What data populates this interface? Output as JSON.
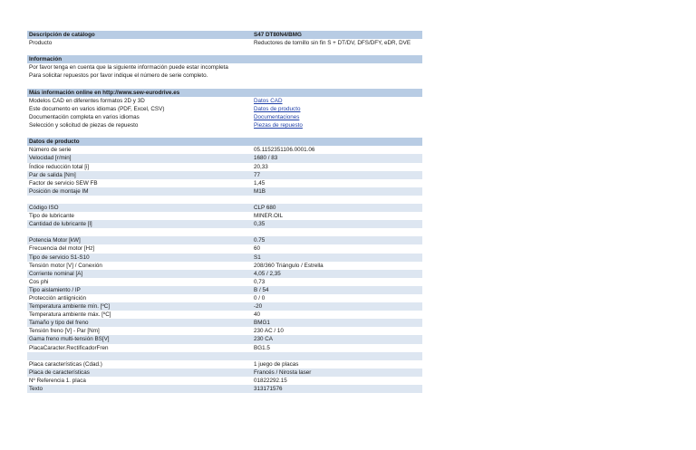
{
  "catalog": {
    "header_label": "Descripción de catálogo",
    "header_value": "S47 DT80N4/BMG",
    "product_label": "Producto",
    "product_value": "Reductores de tornillo sin fin S + DT/DV, DFS/DFY, eDR, DVE"
  },
  "info": {
    "title": "Información",
    "line1": "Por favor tenga en cuenta que la siguiente información puede estar incompleta",
    "line2": "Para solicitar repuestos por favor indique el número de serie completo."
  },
  "online": {
    "title": "Más información online en http://www.sew-eurodrive.es",
    "rows": [
      {
        "label": "Modelos CAD en diferentes formatos 2D y 3D",
        "link": "Datos CAD"
      },
      {
        "label": "Este documento en varios idiomas (PDF, Excel, CSV)",
        "link": "Datos de producto"
      },
      {
        "label": "Documentación completa en varios idiomas",
        "link": "Documentaciones"
      },
      {
        "label": "Selección y solicitud de piezas de repuesto",
        "link": "Piezas de repuesto"
      }
    ]
  },
  "product_data": {
    "title": "Datos de producto",
    "group1": [
      {
        "label": "Número de serie",
        "value": "05.1152351106.0001.06"
      },
      {
        "label": "Velocidad [r/min]",
        "value": "1680 / 83"
      },
      {
        "label": "Índice reducción total [i]",
        "value": "20,33"
      },
      {
        "label": "Par de salida [Nm]",
        "value": "77"
      },
      {
        "label": "Factor de servicio SEW FB",
        "value": "1,45"
      },
      {
        "label": "Posición de montaje IM",
        "value": "M1B"
      }
    ],
    "group2": [
      {
        "label": "Código ISO",
        "value": "CLP 680"
      },
      {
        "label": "Tipo de lubricante",
        "value": "MINER.OIL"
      },
      {
        "label": "Cantidad de lubricante [l]",
        "value": "0,35"
      }
    ],
    "group3": [
      {
        "label": "Potencia Motor [kW]",
        "value": "0.75"
      },
      {
        "label": "Frecuencia del motor [Hz]",
        "value": "60"
      },
      {
        "label": "Tipo de servicio S1-S10",
        "value": "S1"
      },
      {
        "label": "Tensión motor [V] / Conexión",
        "value": "208/360 Triángulo / Estrella"
      },
      {
        "label": "Corriente nominal [A]",
        "value": "4,05 / 2,35"
      },
      {
        "label": "Cos phi",
        "value": "0,73"
      },
      {
        "label": "Tipo aislamiento / IP",
        "value": "B / 54"
      },
      {
        "label": "Protección antiignición",
        "value": "0 / 0"
      },
      {
        "label": "Temperatura ambiente mín. [ºC]",
        "value": "-20"
      },
      {
        "label": "Temperatura ambiente máx. [ºC]",
        "value": "40"
      },
      {
        "label": "Tamaño y tipo del freno",
        "value": "BMG1"
      },
      {
        "label": "Tensión freno [V] - Par [Nm]",
        "value": "230 AC / 10"
      },
      {
        "label": "Gama freno multi-tensión BS[V]",
        "value": "230 CA"
      },
      {
        "label": "PlacaCaracter.RectificadorFren",
        "value": "BG1.5"
      }
    ],
    "group4": [
      {
        "label": "Placa características (Cdad.)",
        "value": "1 juego de placas"
      },
      {
        "label": "Placa de características",
        "value": "Francés / Nirosta laser"
      },
      {
        "label": "Nº Referencia 1. placa",
        "value": "01822292.15"
      },
      {
        "label": "Texto",
        "value": "313171576"
      }
    ]
  }
}
